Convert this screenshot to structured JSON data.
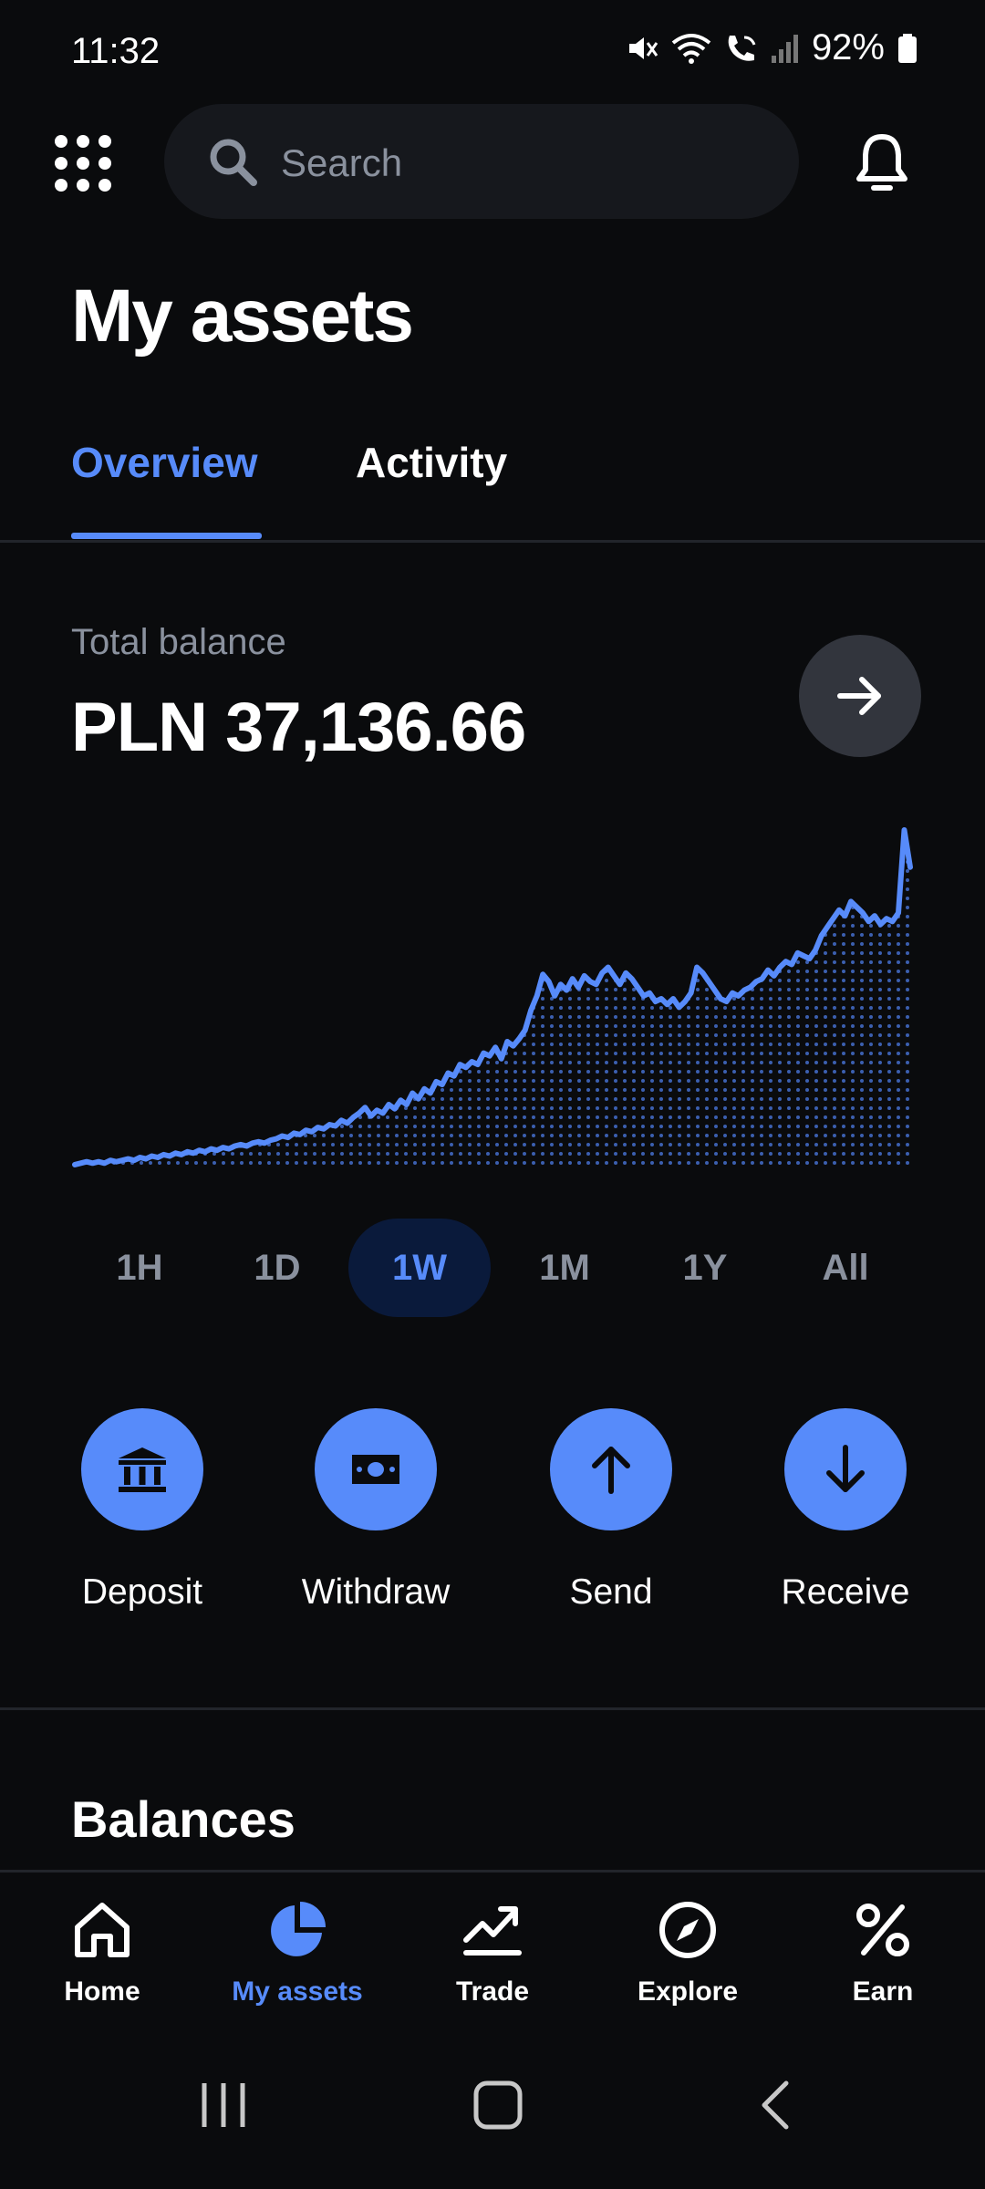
{
  "status_bar": {
    "time": "11:32",
    "battery": "92%",
    "icons": [
      "mute-icon",
      "wifi-icon",
      "wifi-call-icon",
      "signal-icon",
      "battery-icon"
    ]
  },
  "header": {
    "search_placeholder": "Search",
    "menu_icon": "grid-icon",
    "notifications_icon": "bell-icon"
  },
  "page": {
    "title": "My assets"
  },
  "tabs": [
    {
      "label": "Overview",
      "active": true
    },
    {
      "label": "Activity",
      "active": false
    }
  ],
  "balance": {
    "label": "Total balance",
    "value": "PLN 37,136.66"
  },
  "chart_data": {
    "type": "area",
    "color": "#578bfa",
    "title": "",
    "xlabel": "",
    "ylabel": "",
    "grid": false,
    "y": [
      2,
      3,
      4,
      3,
      4,
      3,
      5,
      4,
      5,
      6,
      5,
      7,
      6,
      8,
      7,
      9,
      8,
      10,
      9,
      11,
      10,
      12,
      11,
      13,
      12,
      14,
      13,
      15,
      16,
      15,
      17,
      18,
      17,
      19,
      20,
      22,
      21,
      24,
      23,
      26,
      25,
      28,
      27,
      30,
      29,
      33,
      31,
      35,
      38,
      42,
      36,
      40,
      38,
      44,
      41,
      47,
      44,
      52,
      48,
      55,
      52,
      60,
      58,
      66,
      64,
      72,
      70,
      74,
      72,
      80,
      78,
      84,
      76,
      88,
      85,
      90,
      96,
      110,
      120,
      135,
      130,
      120,
      128,
      124,
      132,
      126,
      134,
      130,
      128,
      136,
      140,
      134,
      128,
      136,
      132,
      126,
      120,
      122,
      116,
      118,
      114,
      118,
      112,
      116,
      122,
      140,
      136,
      130,
      124,
      118,
      116,
      122,
      120,
      124,
      126,
      130,
      132,
      138,
      134,
      140,
      144,
      142,
      150,
      148,
      146,
      152,
      162,
      168,
      174,
      180,
      176,
      186,
      182,
      178,
      172,
      176,
      170,
      174,
      172,
      178,
      236,
      210
    ]
  },
  "ranges": [
    {
      "label": "1H",
      "active": false
    },
    {
      "label": "1D",
      "active": false
    },
    {
      "label": "1W",
      "active": true
    },
    {
      "label": "1M",
      "active": false
    },
    {
      "label": "1Y",
      "active": false
    },
    {
      "label": "All",
      "active": false
    }
  ],
  "actions": [
    {
      "label": "Deposit",
      "icon": "bank-icon"
    },
    {
      "label": "Withdraw",
      "icon": "cash-icon"
    },
    {
      "label": "Send",
      "icon": "arrow-up-icon"
    },
    {
      "label": "Receive",
      "icon": "arrow-down-icon"
    }
  ],
  "sections": {
    "balances_title": "Balances"
  },
  "bottom_nav": [
    {
      "label": "Home",
      "icon": "home-icon",
      "active": false
    },
    {
      "label": "My assets",
      "icon": "pie-chart-icon",
      "active": true
    },
    {
      "label": "Trade",
      "icon": "trend-icon",
      "active": false
    },
    {
      "label": "Explore",
      "icon": "compass-icon",
      "active": false
    },
    {
      "label": "Earn",
      "icon": "percent-icon",
      "active": false
    }
  ],
  "system_nav": {
    "icons": [
      "recents-icon",
      "home-square-icon",
      "back-icon"
    ]
  },
  "colors": {
    "accent": "#578bfa",
    "background": "#0a0b0d",
    "muted_text": "#8a919e"
  }
}
